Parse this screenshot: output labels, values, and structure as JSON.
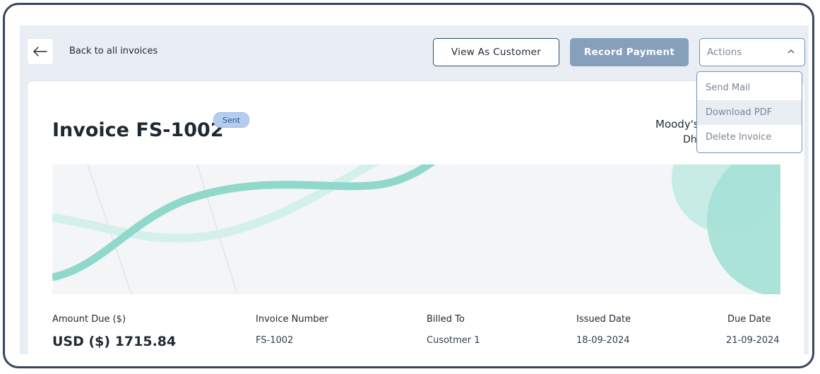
{
  "header": {
    "back_label": "Back to all invoices",
    "view_as_customer": "View As Customer",
    "record_payment": "Record Payment",
    "actions_label": "Actions"
  },
  "actions_menu": {
    "items": [
      {
        "label": "Send Mail"
      },
      {
        "label": "Download PDF"
      },
      {
        "label": "Delete Invoice"
      }
    ]
  },
  "invoice": {
    "title": "Invoice FS-1002",
    "status": "Sent",
    "company_name": "Moody's",
    "company_city": "Dha"
  },
  "details": {
    "amount_due_label": "Amount Due ($)",
    "amount_due_value": "USD ($) 1715.84",
    "invoice_number_label": "Invoice Number",
    "invoice_number_value": "FS-1002",
    "billed_to_label": "Billed To",
    "billed_to_value": "Cusotmer 1",
    "issued_date_label": "Issued Date",
    "issued_date_value": "18-09-2024",
    "due_date_label": "Due Date",
    "due_date_value": "21-09-2024"
  },
  "colors": {
    "accent": "#86a0bb",
    "wave": "#8fd8cb",
    "badge": "#b4ccee"
  }
}
